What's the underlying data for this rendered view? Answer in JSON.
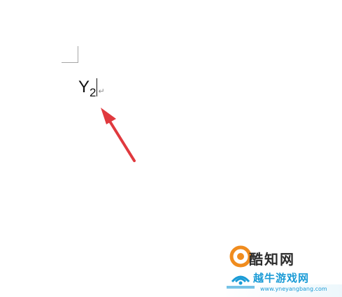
{
  "document": {
    "equation_base": "Y",
    "equation_subscript": "2",
    "paragraph_mark": "↵"
  },
  "annotation": {
    "arrow_color": "#e0393e"
  },
  "watermark": {
    "brand_top": "酷知网",
    "brand_bottom": "越牛游戏网",
    "url": "www.yneyangbang.com",
    "accent_orange": "#f08c1e",
    "accent_blue": "#1a9bd6"
  }
}
